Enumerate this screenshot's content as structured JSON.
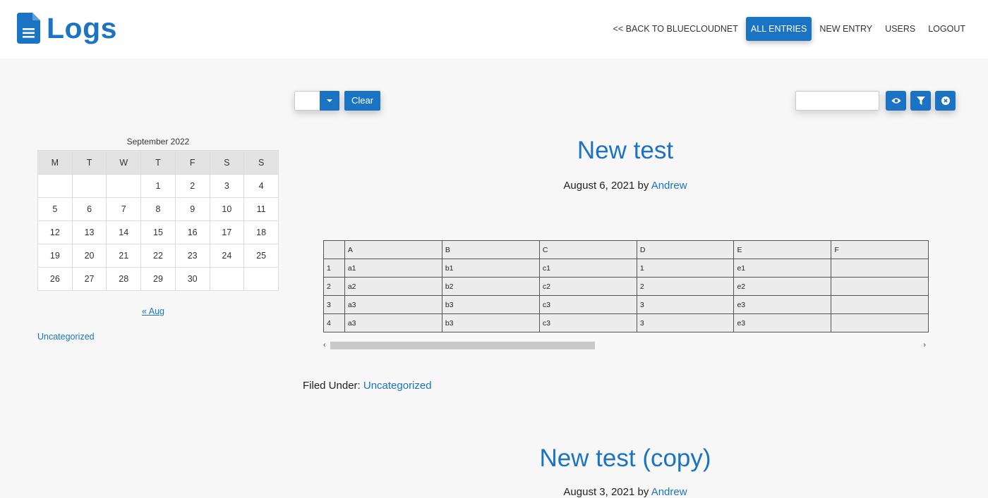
{
  "header": {
    "logo_text": "Logs",
    "brand_color": "#1b74c3",
    "nav": {
      "back": "<< BACK TO BLUECLOUDNET",
      "all_entries": "ALL ENTRIES",
      "new_entry": "NEW ENTRY",
      "users": "USERS",
      "logout": "LOGOUT"
    }
  },
  "toolbar": {
    "select_value": "",
    "clear_label": "Clear",
    "search_value": "",
    "icons": [
      "eye-icon",
      "filter-icon",
      "close-circle-icon"
    ]
  },
  "calendar": {
    "caption": "September 2022",
    "days": [
      "M",
      "T",
      "W",
      "T",
      "F",
      "S",
      "S"
    ],
    "weeks": [
      [
        "",
        "",
        "",
        "1",
        "2",
        "3",
        "4"
      ],
      [
        "5",
        "6",
        "7",
        "8",
        "9",
        "10",
        "11"
      ],
      [
        "12",
        "13",
        "14",
        "15",
        "16",
        "17",
        "18"
      ],
      [
        "19",
        "20",
        "21",
        "22",
        "23",
        "24",
        "25"
      ],
      [
        "26",
        "27",
        "28",
        "29",
        "30",
        "",
        ""
      ]
    ],
    "prev_link": "« Aug"
  },
  "sidebar": {
    "category_link": "Uncategorized"
  },
  "post1": {
    "title": "New test",
    "date": "August 6, 2021",
    "by": "by",
    "author": "Andrew",
    "table": {
      "header": [
        "",
        "A",
        "B",
        "C",
        "D",
        "E",
        "F"
      ],
      "rows": [
        [
          "1",
          "a1",
          "b1",
          "c1",
          "1",
          "e1",
          ""
        ],
        [
          "2",
          "a2",
          "b2",
          "c2",
          "2",
          "e2",
          ""
        ],
        [
          "3",
          "a3",
          "b3",
          "c3",
          "3",
          "e3",
          ""
        ],
        [
          "4",
          "a3",
          "b3",
          "c3",
          "3",
          "e3",
          ""
        ]
      ]
    },
    "filed_label": "Filed Under:",
    "filed_category": "Uncategorized"
  },
  "post2": {
    "title": "New test (copy)",
    "date": "August 3, 2021",
    "by": "by",
    "author": "Andrew"
  }
}
